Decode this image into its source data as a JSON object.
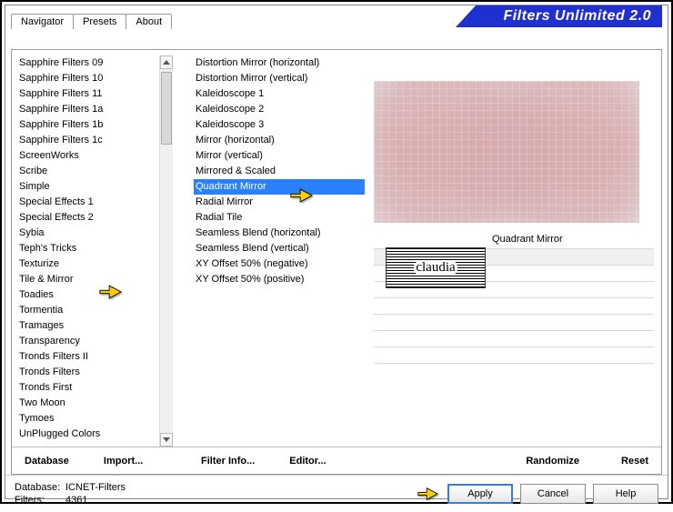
{
  "window": {
    "title": "Filters Unlimited 2.0"
  },
  "tabs": [
    {
      "label": "Navigator",
      "active": true
    },
    {
      "label": "Presets",
      "active": false
    },
    {
      "label": "About",
      "active": false
    }
  ],
  "categories": {
    "items": [
      "Sapphire Filters 09",
      "Sapphire Filters 10",
      "Sapphire Filters 11",
      "Sapphire Filters 1a",
      "Sapphire Filters 1b",
      "Sapphire Filters 1c",
      "ScreenWorks",
      "Scribe",
      "Simple",
      "Special Effects 1",
      "Special Effects 2",
      "Sybia",
      "Teph's Tricks",
      "Texturize",
      "Tile & Mirror",
      "Toadies",
      "Tormentia",
      "Tramages",
      "Transparency",
      "Tronds Filters II",
      "Tronds Filters",
      "Tronds First",
      "Two Moon",
      "Tymoes",
      "UnPlugged Colors"
    ],
    "selected": "Tile & Mirror"
  },
  "filters": {
    "items": [
      "Distortion Mirror (horizontal)",
      "Distortion Mirror (vertical)",
      "Kaleidoscope 1",
      "Kaleidoscope 2",
      "Kaleidoscope 3",
      "Mirror (horizontal)",
      "Mirror (vertical)",
      "Mirrored & Scaled",
      "Quadrant Mirror",
      "Radial Mirror",
      "Radial Tile",
      "Seamless Blend (horizontal)",
      "Seamless Blend (vertical)",
      "XY Offset 50% (negative)",
      "XY Offset 50% (positive)"
    ],
    "selected": "Quadrant Mirror"
  },
  "preview": {
    "filter_name": "Quadrant Mirror"
  },
  "toolbar": {
    "database": "Database",
    "import": "Import...",
    "filter_info": "Filter Info...",
    "editor": "Editor...",
    "randomize": "Randomize",
    "reset": "Reset"
  },
  "status": {
    "database_label": "Database:",
    "database_value": "ICNET-Filters",
    "filters_label": "Filters:",
    "filters_count": "4361"
  },
  "buttons": {
    "apply": "Apply",
    "cancel": "Cancel",
    "help": "Help"
  },
  "stamp": {
    "text": "claudia"
  }
}
